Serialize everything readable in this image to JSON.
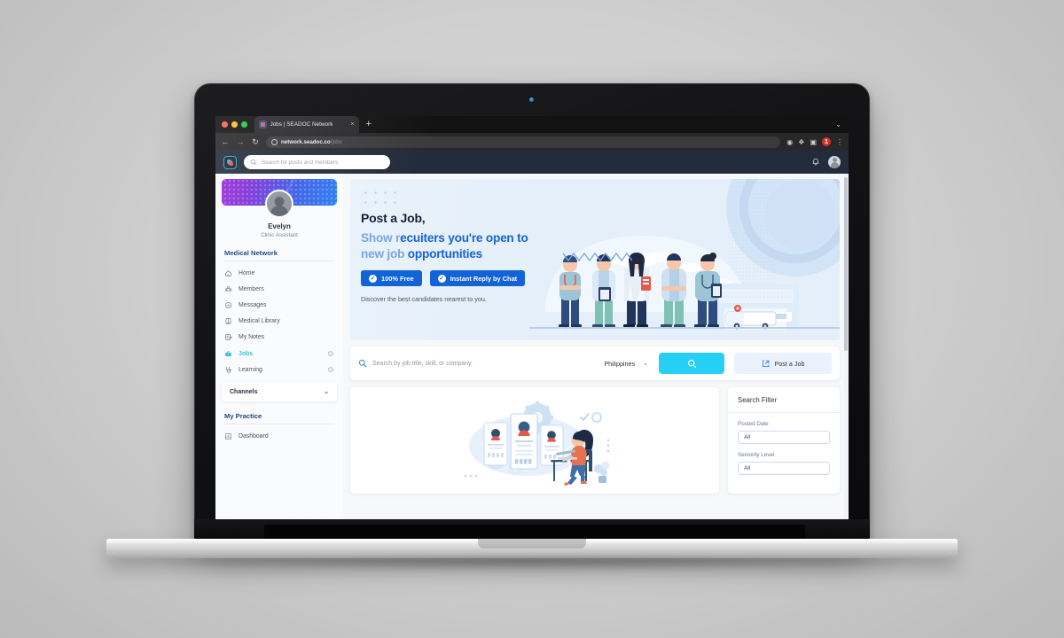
{
  "browser": {
    "tab_title": "Jobs | SEADOC Network",
    "tab_close": "×",
    "new_tab": "+",
    "tabbar_chevron": "⌄",
    "back_icon": "←",
    "forward_icon": "→",
    "reload_icon": "↻",
    "url_domain": "network.seadoc.co",
    "url_path": "/jobs",
    "ext_camera": "◉",
    "ext_puzzle": "❖",
    "ext_reader": "▣",
    "ext_badge": "1",
    "ext_menu": "⋮"
  },
  "appheader": {
    "logo": "seadoc-logo",
    "search_placeholder": "Search for posts and members",
    "search_icon": "⚲",
    "bell_icon": "🔔",
    "avatar": "user-avatar"
  },
  "sidebar": {
    "user_name": "Evelyn",
    "user_role": "Clinic Assistant",
    "section_network": "Medical Network",
    "items": [
      {
        "label": "Home",
        "icon": "home-icon",
        "active": false,
        "clock": false
      },
      {
        "label": "Members",
        "icon": "members-icon",
        "active": false,
        "clock": false
      },
      {
        "label": "Messages",
        "icon": "messages-icon",
        "active": false,
        "clock": false
      },
      {
        "label": "Medical Library",
        "icon": "library-icon",
        "active": false,
        "clock": false
      },
      {
        "label": "My Notes",
        "icon": "notes-icon",
        "active": false,
        "clock": false
      },
      {
        "label": "Jobs",
        "icon": "briefcase-icon",
        "active": true,
        "clock": true
      },
      {
        "label": "Learning",
        "icon": "stethoscope-icon",
        "active": false,
        "clock": true
      }
    ],
    "channels_label": "Channels",
    "channels_chevron": "⌄",
    "section_practice": "My Practice",
    "practice_items": [
      {
        "label": "Dashboard",
        "icon": "dashboard-icon"
      }
    ],
    "active_color": "#3ab9d6",
    "section_color": "#1a3a7a"
  },
  "hero": {
    "title": "Post a Job,",
    "subtitle_part1": "Show r",
    "subtitle_part2": "ecuiters you're open to",
    "subtitle_line2_light": "new job",
    "subtitle_line2_bold": " opportunities",
    "badge_free": "100% Free",
    "badge_chat": "Instant Reply by Chat",
    "badge_check": "✓",
    "description": "Discover the best candidates nearest to you.",
    "accent_color": "#1262d8",
    "bg_color": "#e9f2fb"
  },
  "search_row": {
    "placeholder": "Search by job title, skill, or company",
    "search_icon": "⚲",
    "location": "Philippines",
    "location_chevron": "⌄",
    "submit_icon": "⚲",
    "post_job_label": "Post a Job",
    "post_job_icon": "↗",
    "submit_color": "#26d0f5"
  },
  "filter": {
    "title": "Search Filter",
    "fields": [
      {
        "label": "Posted Date",
        "value": "All"
      },
      {
        "label": "Seniority Level",
        "value": "All"
      }
    ]
  },
  "joblist": {
    "illustration": "recruitment-illustration"
  }
}
